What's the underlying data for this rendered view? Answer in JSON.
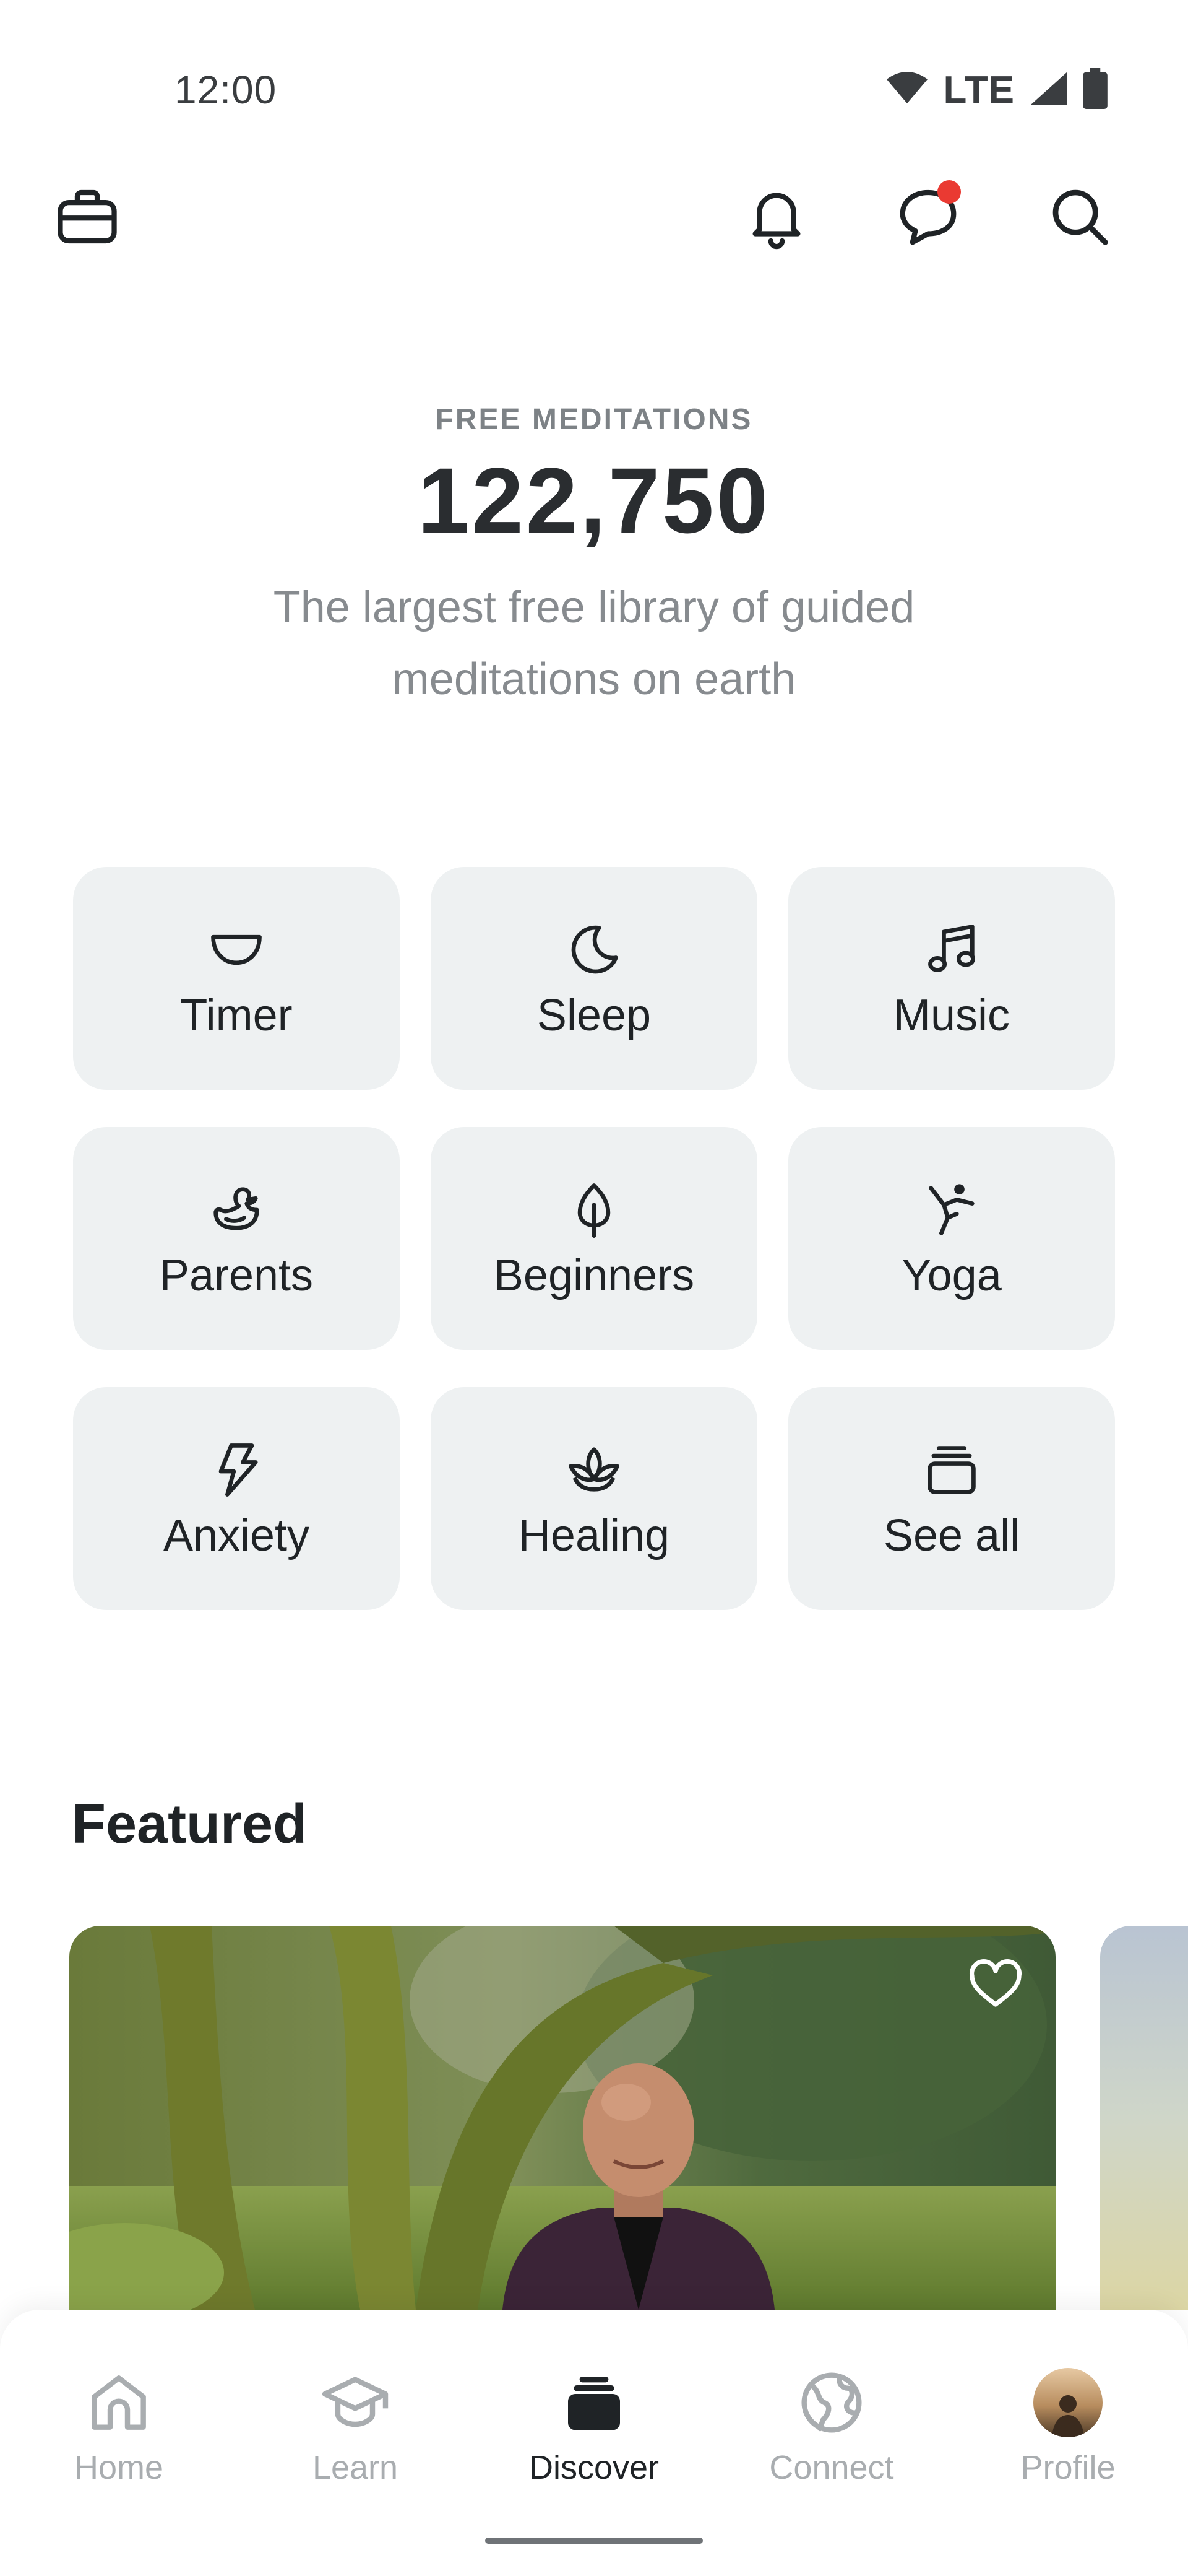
{
  "status_bar": {
    "time": "12:00",
    "network": "LTE"
  },
  "top_bar": {
    "icons": [
      "briefcase-icon",
      "bell-icon",
      "chat-icon",
      "search-icon"
    ],
    "has_chat_notification": true,
    "notification_color": "#ea3a32"
  },
  "hero": {
    "kicker": "FREE MEDITATIONS",
    "count": "122,750",
    "subtitle_line1": "The largest free library of guided",
    "subtitle_line2": "meditations on earth"
  },
  "categories": [
    {
      "label": "Timer",
      "icon": "bowl-icon"
    },
    {
      "label": "Sleep",
      "icon": "moon-icon"
    },
    {
      "label": "Music",
      "icon": "music-note-icon"
    },
    {
      "label": "Parents",
      "icon": "duck-icon"
    },
    {
      "label": "Beginners",
      "icon": "leaf-icon"
    },
    {
      "label": "Yoga",
      "icon": "yoga-pose-icon"
    },
    {
      "label": "Anxiety",
      "icon": "lightning-icon"
    },
    {
      "label": "Healing",
      "icon": "lotus-icon"
    },
    {
      "label": "See all",
      "icon": "stack-icon"
    }
  ],
  "featured": {
    "title": "Featured",
    "card_favorite_icon": "heart-icon"
  },
  "bottom_nav": {
    "items": [
      {
        "label": "Home",
        "icon": "home-icon",
        "active": false
      },
      {
        "label": "Learn",
        "icon": "graduation-cap-icon",
        "active": false
      },
      {
        "label": "Discover",
        "icon": "discover-stack-icon",
        "active": true
      },
      {
        "label": "Connect",
        "icon": "globe-icon",
        "active": false
      },
      {
        "label": "Profile",
        "icon": "avatar",
        "active": false
      }
    ]
  },
  "colors": {
    "tile_background": "#eef1f2",
    "text_primary": "#1f2326",
    "text_muted": "#878b8f",
    "nav_inactive": "#a9adb0"
  }
}
